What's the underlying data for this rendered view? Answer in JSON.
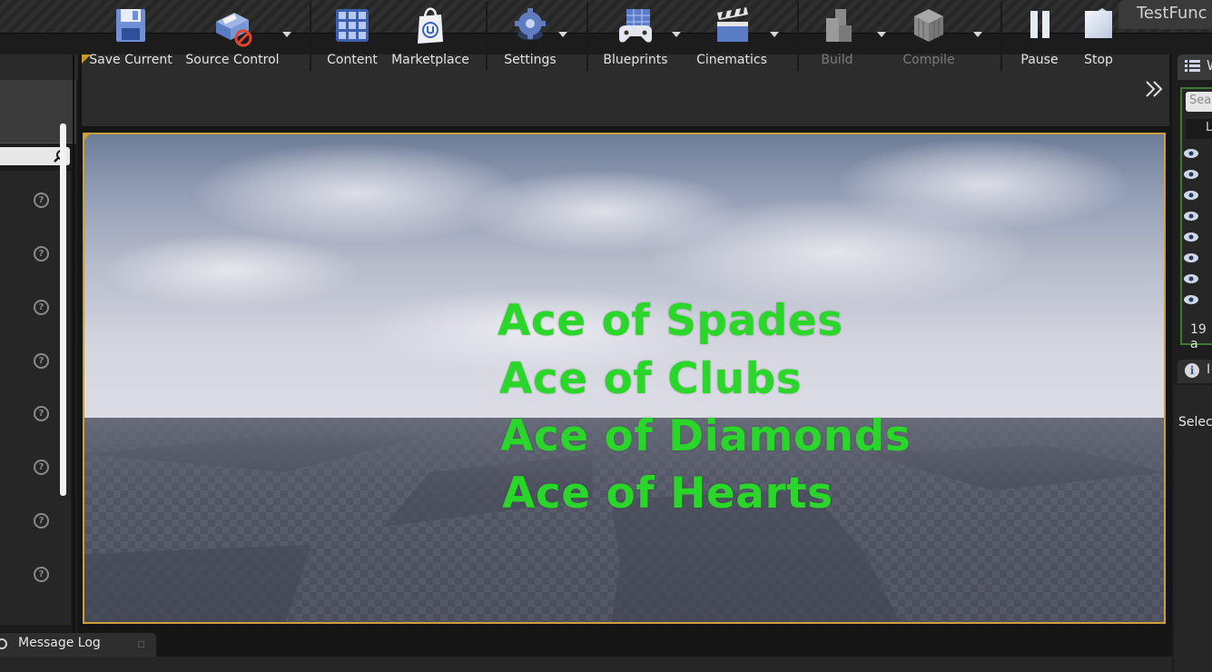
{
  "window": {
    "tab_title": "TestFunc"
  },
  "toolbar": {
    "buttons": [
      {
        "label": "Save Current",
        "icon": "save-icon"
      },
      {
        "label": "Source Control",
        "icon": "source-control-icon"
      },
      {
        "label": "Content",
        "icon": "content-icon"
      },
      {
        "label": "Marketplace",
        "icon": "marketplace-icon"
      },
      {
        "label": "Settings",
        "icon": "settings-icon"
      },
      {
        "label": "Blueprints",
        "icon": "blueprints-icon"
      },
      {
        "label": "Cinematics",
        "icon": "cinematics-icon"
      },
      {
        "label": "Build",
        "icon": "build-icon",
        "disabled": true
      },
      {
        "label": "Compile",
        "icon": "compile-icon",
        "disabled": true
      },
      {
        "label": "Pause",
        "icon": "pause-icon"
      },
      {
        "label": "Stop",
        "icon": "stop-icon"
      }
    ],
    "more_icon": "chevron-double-right-icon"
  },
  "viewport": {
    "lines": [
      "Ace of Spades",
      "Ace of Clubs",
      "Ace of Diamonds",
      "Ace of Hearts"
    ],
    "text_color": "#2ad62a",
    "border_color": "#c8a13a"
  },
  "world_outliner": {
    "tab_label": "W",
    "search_placeholder": "Sear",
    "column_label": "L",
    "count_text": "19 a"
  },
  "details": {
    "tab_label": "I",
    "empty_text": "Selec"
  },
  "message_log": {
    "tab_label": "Message Log"
  },
  "colors": {
    "accent_gold": "#c8a13a",
    "outliner_green": "#3b7a2f"
  }
}
